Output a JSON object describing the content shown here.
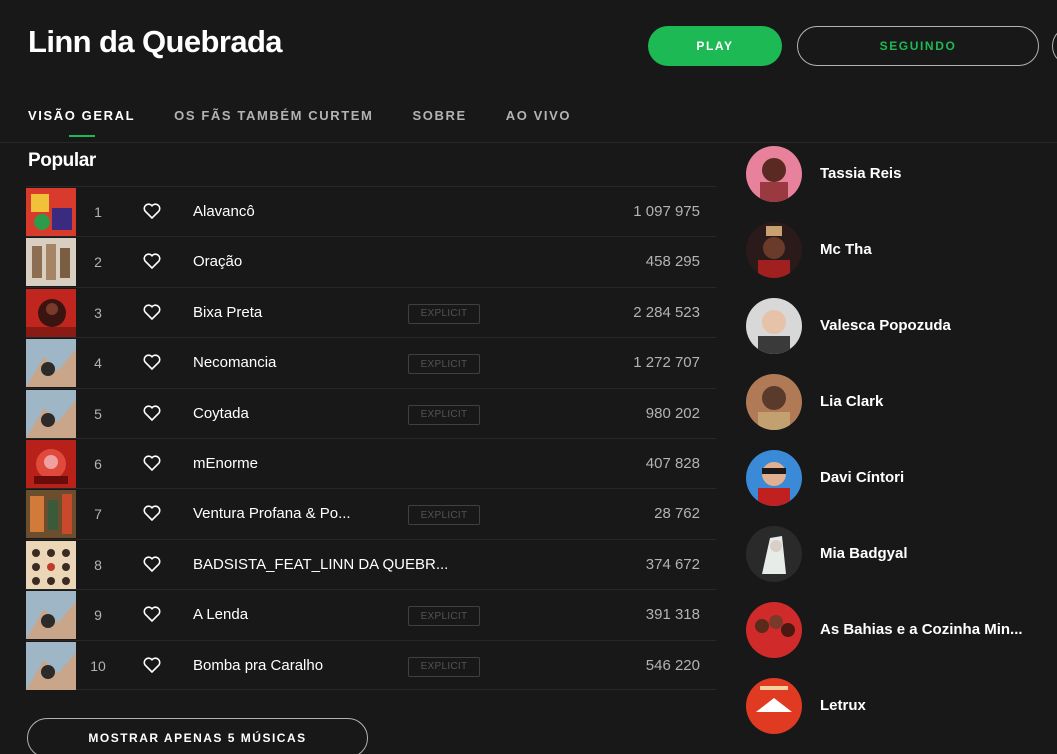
{
  "artist": {
    "name": "Linn da Quebrada"
  },
  "actions": {
    "play_label": "PLAY",
    "follow_label": "SEGUINDO"
  },
  "tabs": [
    {
      "label": "VISÃO GERAL",
      "active": true
    },
    {
      "label": "OS FÃS TAMBÉM CURTEM",
      "active": false
    },
    {
      "label": "SOBRE",
      "active": false
    },
    {
      "label": "AO VIVO",
      "active": false
    }
  ],
  "popular": {
    "title": "Popular",
    "explicit_label": "EXPLICIT",
    "tracks": [
      {
        "num": "1",
        "title": "Alavancô",
        "explicit": false,
        "plays": "1 097 975"
      },
      {
        "num": "2",
        "title": "Oração",
        "explicit": false,
        "plays": "458 295"
      },
      {
        "num": "3",
        "title": "Bixa Preta",
        "explicit": true,
        "plays": "2 284 523"
      },
      {
        "num": "4",
        "title": "Necomancia",
        "explicit": true,
        "plays": "1 272 707"
      },
      {
        "num": "5",
        "title": "Coytada",
        "explicit": true,
        "plays": "980 202"
      },
      {
        "num": "6",
        "title": "mEnorme",
        "explicit": false,
        "plays": "407 828"
      },
      {
        "num": "7",
        "title": "Ventura Profana & Po...",
        "explicit": true,
        "plays": "28 762"
      },
      {
        "num": "8",
        "title": "BADSISTA_FEAT_LINN DA QUEBR...",
        "explicit": false,
        "plays": "374 672"
      },
      {
        "num": "9",
        "title": "A Lenda",
        "explicit": true,
        "plays": "391 318"
      },
      {
        "num": "10",
        "title": "Bomba pra Caralho",
        "explicit": true,
        "plays": "546 220"
      }
    ],
    "show_less_label": "MOSTRAR APENAS 5 MÚSICAS"
  },
  "related_artists": [
    {
      "name": "Tassia Reis"
    },
    {
      "name": "Mc Tha"
    },
    {
      "name": "Valesca Popozuda"
    },
    {
      "name": "Lia Clark"
    },
    {
      "name": "Davi Cíntori"
    },
    {
      "name": "Mia Badgyal"
    },
    {
      "name": "As Bahias e a Cozinha Min..."
    },
    {
      "name": "Letrux"
    }
  ],
  "colors": {
    "background": "#181818",
    "accent": "#1db954",
    "muted_text": "#b3b3b3"
  }
}
